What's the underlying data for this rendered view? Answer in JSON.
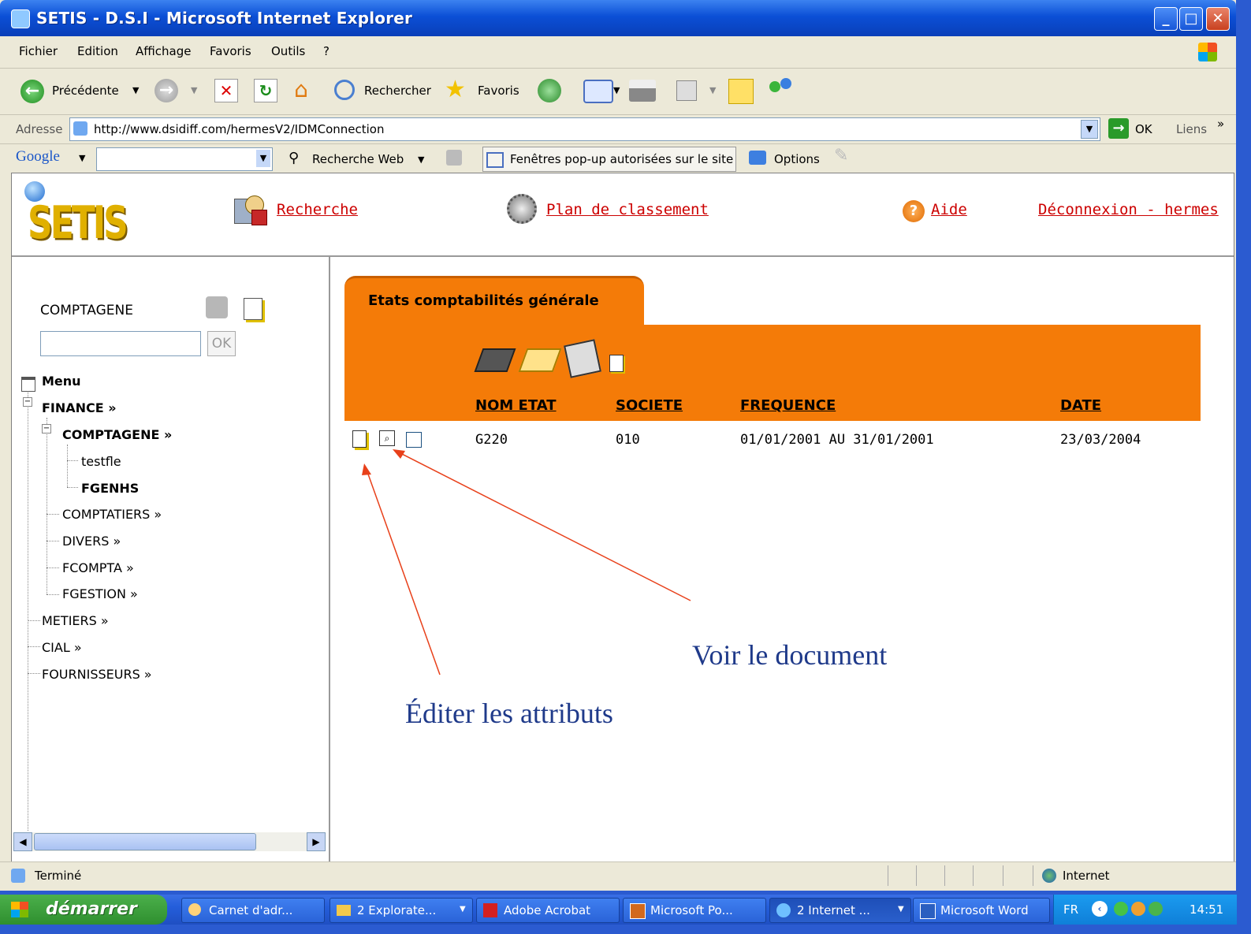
{
  "window": {
    "title": "SETIS - D.S.I - Microsoft Internet Explorer"
  },
  "menu": [
    "Fichier",
    "Edition",
    "Affichage",
    "Favoris",
    "Outils",
    "?"
  ],
  "toolbar": {
    "back": "Précédente",
    "search": "Rechercher",
    "favorites": "Favoris"
  },
  "address": {
    "label": "Adresse",
    "url": "http://www.dsidiff.com/hermesV2/IDMConnection",
    "go": "OK",
    "links": "Liens"
  },
  "google": {
    "logo": "Google",
    "search_web": "Recherche Web",
    "popup": "Fenêtres pop-up autorisées sur le site",
    "options": "Options"
  },
  "header": {
    "logo": "SETIS",
    "recherche": "Recherche",
    "plan": "Plan de classement",
    "aide": "Aide",
    "logout": "Déconnexion - hermes"
  },
  "left": {
    "search_label": "COMPTAGENE",
    "search_value": "",
    "ok": "OK",
    "menu_title": "Menu",
    "tree": {
      "finance": "FINANCE »",
      "comptagene": "COMPTAGENE »",
      "testfle": "testfle",
      "fgenhs": "FGENHS",
      "comptatiers": "COMPTATIERS »",
      "divers": "DIVERS »",
      "fcompta": "FCOMPTA »",
      "fgestion": "FGESTION »",
      "metiers": "METIERS »",
      "cial": "CIAL »",
      "fournisseurs": "FOURNISSEURS »"
    }
  },
  "main": {
    "tab": "Etats comptabilités générale",
    "columns": [
      "NOM ETAT",
      "SOCIETE",
      "FREQUENCE",
      "DATE"
    ],
    "rows": [
      [
        "G220",
        "010",
        "01/01/2001 AU 31/01/2001",
        "23/03/2004"
      ]
    ]
  },
  "annotations": {
    "voir": "Voir le document",
    "editer": "Éditer les attributs"
  },
  "status": {
    "left": "Terminé",
    "zone": "Internet"
  },
  "taskbar": {
    "start": "démarrer",
    "tasks": [
      "Carnet d'adr...",
      "2 Explorate...",
      "Adobe Acrobat",
      "Microsoft Po...",
      "2 Internet ...",
      "Microsoft Word"
    ],
    "lang": "FR",
    "time": "14:51"
  }
}
